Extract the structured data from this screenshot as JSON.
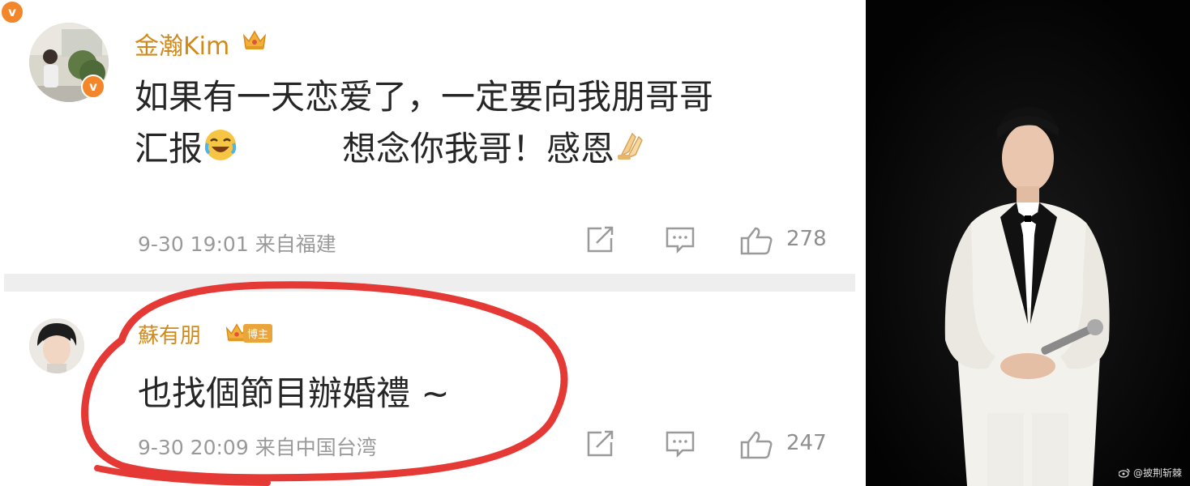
{
  "comments": [
    {
      "username": "金瀚Kim",
      "text_line1": "如果有一天恋爱了，一定要向我朋哥哥",
      "text_line2_a": "汇报",
      "text_line2_b": "想念你我哥！感恩",
      "time": "9-30 19:01",
      "source": "来自福建",
      "likes": "278"
    },
    {
      "username": "蘇有朋",
      "badge": "博主",
      "text": "也找個節目辦婚禮 ~",
      "time": "9-30 20:09",
      "source": "来自中国台湾",
      "likes": "247"
    }
  ],
  "watermark": "@披荆斩棘",
  "colors": {
    "username": "#d08a1c",
    "verified": "#f3862b",
    "annotation": "#e53935"
  }
}
